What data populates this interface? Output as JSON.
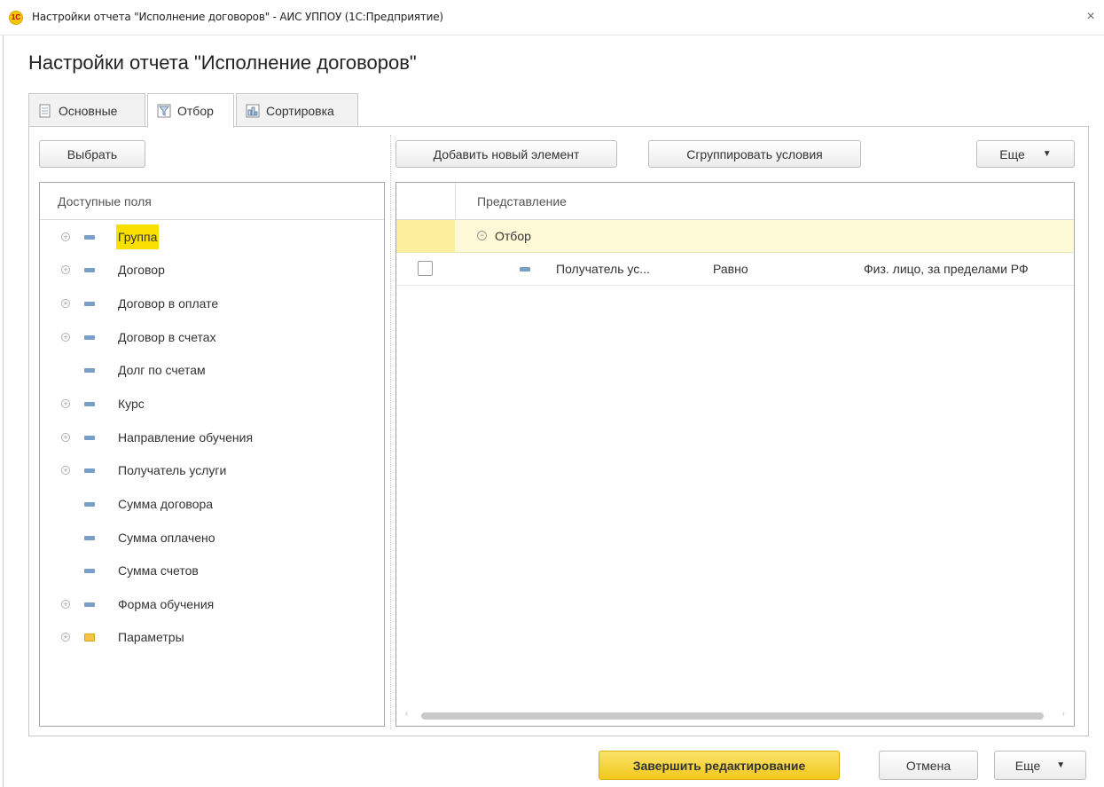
{
  "window": {
    "title": "Настройки отчета \"Исполнение договоров\" - АИС УППОУ  (1С:Предприятие)",
    "logo_text": "1С",
    "close_symbol": "×"
  },
  "form": {
    "heading": "Настройки отчета \"Исполнение договоров\""
  },
  "tabs": [
    {
      "label": "Основные",
      "icon": "document-icon",
      "active": false
    },
    {
      "label": "Отбор",
      "icon": "filter-icon",
      "active": true
    },
    {
      "label": "Сортировка",
      "icon": "sort-icon",
      "active": false
    }
  ],
  "left_panel": {
    "select_button": "Выбрать",
    "header": "Доступные поля",
    "expand_symbol": "+",
    "items": [
      {
        "label": "Группа",
        "expandable": true,
        "icon": "field-icon",
        "selected": true
      },
      {
        "label": "Договор",
        "expandable": true,
        "icon": "field-icon",
        "selected": false
      },
      {
        "label": "Договор в оплате",
        "expandable": true,
        "icon": "field-icon",
        "selected": false
      },
      {
        "label": "Договор в счетах",
        "expandable": true,
        "icon": "field-icon",
        "selected": false
      },
      {
        "label": "Долг по счетам",
        "expandable": false,
        "icon": "field-icon",
        "selected": false
      },
      {
        "label": "Курс",
        "expandable": true,
        "icon": "field-icon",
        "selected": false
      },
      {
        "label": "Направление обучения",
        "expandable": true,
        "icon": "field-icon",
        "selected": false
      },
      {
        "label": "Получатель услуги",
        "expandable": true,
        "icon": "field-icon",
        "selected": false
      },
      {
        "label": "Сумма договора",
        "expandable": false,
        "icon": "field-icon",
        "selected": false
      },
      {
        "label": "Сумма оплачено",
        "expandable": false,
        "icon": "field-icon",
        "selected": false
      },
      {
        "label": "Сумма счетов",
        "expandable": false,
        "icon": "field-icon",
        "selected": false
      },
      {
        "label": "Форма обучения",
        "expandable": true,
        "icon": "field-icon",
        "selected": false
      },
      {
        "label": "Параметры",
        "expandable": true,
        "icon": "folder-icon",
        "selected": false
      }
    ]
  },
  "right_panel": {
    "add_button": "Добавить новый элемент",
    "group_button": "Сгруппировать условия",
    "more_button": "Еще",
    "column_header": "Представление",
    "group_row": {
      "collapse_symbol": "−",
      "label": "Отбор"
    },
    "conditions": [
      {
        "field": "Получатель ус...",
        "comparison": "Равно",
        "value": "Физ. лицо, за пределами РФ",
        "checked": false
      }
    ],
    "scroll_left": "‹",
    "scroll_right": "›"
  },
  "footer": {
    "finish_button": "Завершить редактирование",
    "cancel_button": "Отмена",
    "more_button": "Еще"
  },
  "colors": {
    "primary_button": "#f2c81c",
    "selection_highlight": "#f9e000",
    "group_row_bg": "#fdf9d6"
  }
}
